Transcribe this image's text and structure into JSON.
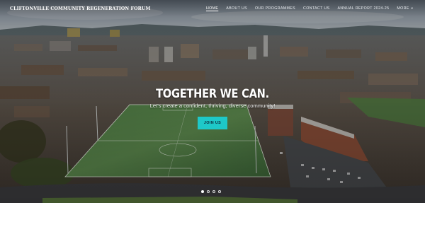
{
  "header": {
    "site_title": "CLIFTONVILLE COMMUNITY REGENERATION FORUM",
    "nav": [
      {
        "label": "HOME",
        "active": true
      },
      {
        "label": "ABOUT US",
        "active": false
      },
      {
        "label": "OUR PROGRAMMES",
        "active": false
      },
      {
        "label": "CONTACT US",
        "active": false
      },
      {
        "label": "ANNUAL REPORT 2024-25",
        "active": false
      }
    ],
    "more_label": "MORE",
    "more_icon": "caret-down-icon"
  },
  "hero": {
    "headline": "TOGETHER WE CAN.",
    "subline": "Let's create a confident, thriving, diverse community!",
    "cta_label": "JOIN US",
    "background": "aerial photo of a floodlit football pitch and north Belfast rooftops under a cloudy sky",
    "carousel": {
      "slides": 4,
      "active_index": 0
    }
  },
  "colors": {
    "accent": "#1ec8c8",
    "nav_text": "#e8ecf0",
    "headline": "#ffffff",
    "page_background": "#ffffff"
  }
}
